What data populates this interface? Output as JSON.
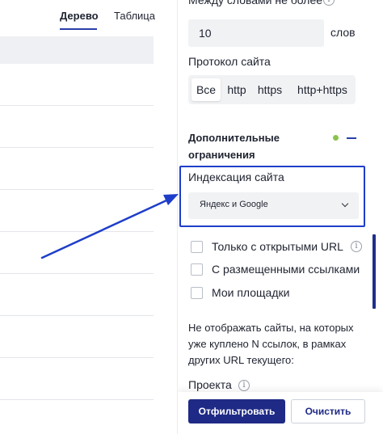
{
  "tabs": {
    "tree": "Дерево",
    "table": "Таблица"
  },
  "filters": {
    "words_between_label": "Между словами не более",
    "words_value": "10",
    "words_unit": "слов",
    "protocol_label": "Протокол сайта",
    "protocol_options": [
      "Все",
      "http",
      "https",
      "http+https"
    ],
    "protocol_selected": "Все",
    "additional_title": "Дополнительные ограничения",
    "indexing_label": "Индексация сайта",
    "indexing_value": "Яндекс и Google",
    "checkboxes": [
      {
        "label": "Только с открытыми URL",
        "checked": false
      },
      {
        "label": "С размещенными ссылками",
        "checked": false
      },
      {
        "label": "Мои площадки",
        "checked": false
      }
    ],
    "note": "Не отображать сайты, на которых уже куплено N ссылок, в рамках других URL текущего:",
    "project_label": "Проекта",
    "filter_button": "Отфильтровать",
    "clear_button": "Очистить"
  },
  "colors": {
    "accent": "#1f2a86",
    "highlight_border": "#1e3ec9",
    "status_dot": "#8bc34a",
    "arrow": "#1e3ec9"
  },
  "icons": {
    "info": "info-circle-icon",
    "dropdown": "chevron-down-icon",
    "collapse": "minus-icon",
    "annotation": "arrow-annotation"
  }
}
